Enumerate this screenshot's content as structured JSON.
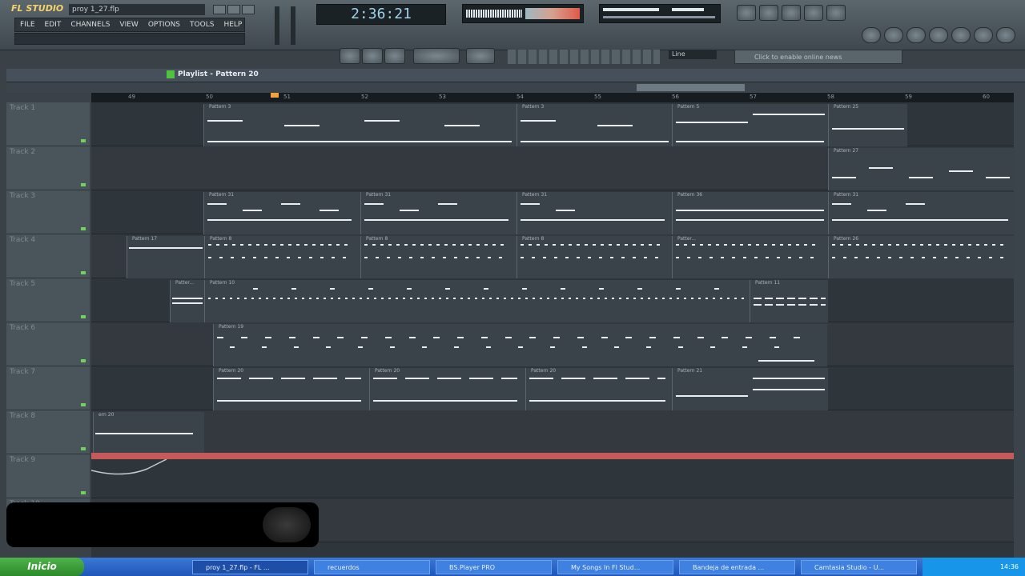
{
  "app": {
    "logo": "FL STUDIO",
    "project_file": "proy 1_27.flp",
    "menu": [
      "FILE",
      "EDIT",
      "CHANNELS",
      "VIEW",
      "OPTIONS",
      "TOOLS",
      "HELP"
    ],
    "time_display": "2:36:21",
    "line_select": "Line",
    "online_news": "Click to enable online news"
  },
  "playlist": {
    "title": "Playlist - Pattern 20",
    "ruler": [
      "49",
      "50",
      "51",
      "52",
      "53",
      "54",
      "55",
      "56",
      "57",
      "58",
      "59",
      "60"
    ],
    "tracks": [
      "Track 1",
      "Track 2",
      "Track 3",
      "Track 4",
      "Track 5",
      "Track 6",
      "Track 7",
      "Track 8",
      "Track 9",
      "Track 10"
    ],
    "clips": [
      {
        "row": 0,
        "label": "Pattern 3"
      },
      {
        "row": 0,
        "label": "Pattern 3"
      },
      {
        "row": 0,
        "label": "Pattern 5"
      },
      {
        "row": 0,
        "label": "Pattern 25"
      },
      {
        "row": 1,
        "label": "Pattern 27"
      },
      {
        "row": 2,
        "label": "Pattern 31"
      },
      {
        "row": 2,
        "label": "Pattern 31"
      },
      {
        "row": 2,
        "label": "Pattern 31"
      },
      {
        "row": 2,
        "label": "Pattern 36"
      },
      {
        "row": 2,
        "label": "Pattern 31"
      },
      {
        "row": 3,
        "label": "Pattern 17"
      },
      {
        "row": 3,
        "label": "Pattern 8"
      },
      {
        "row": 3,
        "label": "Pattern 8"
      },
      {
        "row": 3,
        "label": "Pattern 8"
      },
      {
        "row": 3,
        "label": "Patter..."
      },
      {
        "row": 3,
        "label": "Pattern 26"
      },
      {
        "row": 4,
        "label": "Patter..."
      },
      {
        "row": 4,
        "label": "Pattern 10"
      },
      {
        "row": 4,
        "label": "Pattern 11"
      },
      {
        "row": 5,
        "label": "Pattern 19"
      },
      {
        "row": 6,
        "label": "Pattern 20"
      },
      {
        "row": 6,
        "label": "Pattern 20"
      },
      {
        "row": 6,
        "label": "Pattern 20"
      },
      {
        "row": 6,
        "label": "Pattern 21"
      },
      {
        "row": 7,
        "label": "ern 20"
      }
    ]
  },
  "taskbar": {
    "start": "Inicio",
    "tasks": [
      "proy 1_27.flp - FL ...",
      "recuerdos",
      "BS.Player PRO",
      "My Songs In Fl Stud...",
      "Bandeja de entrada ...",
      "Camtasia Studio - U..."
    ],
    "clock": "14:36"
  }
}
